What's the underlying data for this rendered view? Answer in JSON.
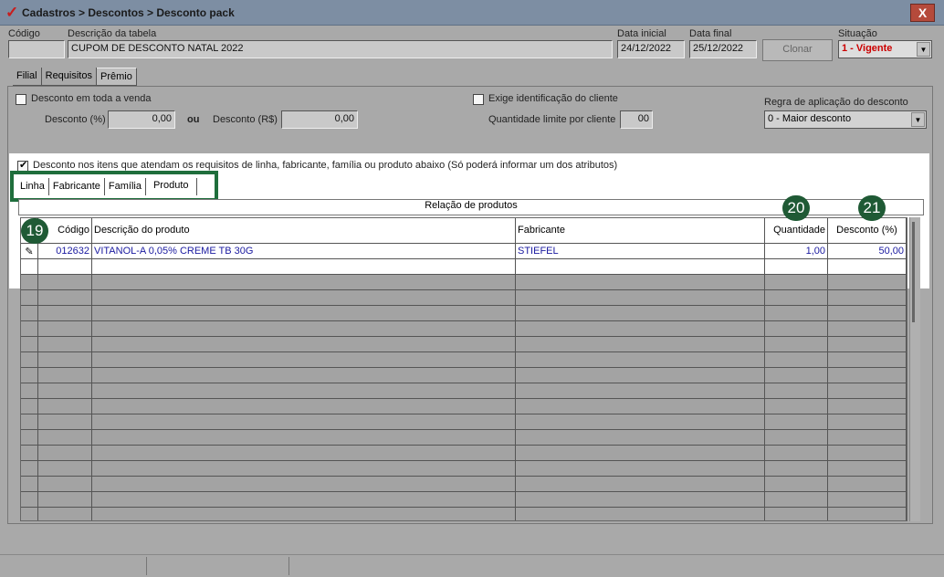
{
  "window": {
    "title": "Cadastros > Descontos > Desconto pack",
    "close_label": "X"
  },
  "header": {
    "codigo_label": "Código",
    "codigo_value": "",
    "descricao_label": "Descrição da tabela",
    "descricao_value": "CUPOM DE DESCONTO NATAL 2022",
    "data_inicial_label": "Data inicial",
    "data_inicial_value": "24/12/2022",
    "data_final_label": "Data final",
    "data_final_value": "25/12/2022",
    "clonar_label": "Clonar",
    "situacao_label": "Situação",
    "situacao_value": "1 - Vigente"
  },
  "tabs": [
    "Filial",
    "Requisitos",
    "Prêmio"
  ],
  "premio": {
    "desconto_toda_venda_label": "Desconto em toda a venda",
    "desconto_pct_label": "Desconto (%)",
    "desconto_pct_value": "0,00",
    "ou_label": "ou",
    "desconto_rs_label": "Desconto (R$)",
    "desconto_rs_value": "0,00",
    "exige_label": "Exige identificação do cliente",
    "qtd_limite_label": "Quantidade limite por cliente",
    "qtd_limite_value": "00",
    "regra_label": "Regra de aplicação do desconto",
    "regra_value": "0 - Maior desconto",
    "desconto_itens_label": "Desconto nos itens que atendam os requisitos de linha, fabricante, família ou produto abaixo (Só poderá informar um dos atributos)"
  },
  "subtabs": [
    "Linha",
    "Fabricante",
    "Família",
    "Produto"
  ],
  "grid": {
    "title": "Relação de produtos",
    "columns": [
      "Código",
      "Descrição do produto",
      "Fabricante",
      "Quantidade",
      "Desconto (%)"
    ],
    "rows": [
      {
        "edit_icon": "✎",
        "codigo": "012632",
        "descricao": "VITANOL-A 0,05% CREME TB 30G",
        "fabricante": "STIEFEL",
        "quantidade": "1,00",
        "desconto": "50,00"
      }
    ]
  },
  "badges": [
    "19",
    "20",
    "21"
  ],
  "colors": {
    "highlight": "#1f6e3c",
    "badge": "#1f5a35",
    "situacao": "#cc0000",
    "row_text": "#1a1aa0"
  }
}
